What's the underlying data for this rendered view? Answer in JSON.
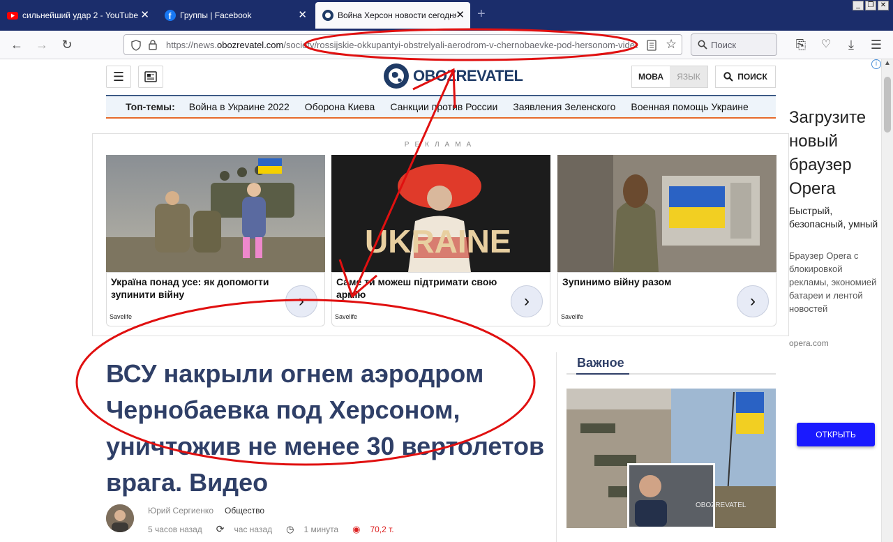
{
  "browser": {
    "tabs": [
      {
        "title": "сильнейший удар 2 - YouTube",
        "icon": "youtube-icon"
      },
      {
        "title": "Группы | Facebook",
        "icon": "facebook-icon"
      },
      {
        "title": "Война Херсон новости сегодня –",
        "icon": "obozrevatel-icon"
      }
    ],
    "url_prefix": "https://news.",
    "url_domain": "obozrevatel.com",
    "url_path": "/society/rossijskie-okkupantyi-obstrelyali-aerodrom-v-chernobaevke-pod-hersonom-video",
    "search_placeholder": "Поиск",
    "colors": {
      "tabbar": "#1b2d6b",
      "annotation": "#e01010"
    }
  },
  "header": {
    "logo_text": "OBOZREVATEL",
    "lang_ua": "МОВА",
    "lang_ru": "ЯЗЫК",
    "search_label": "ПОИСК"
  },
  "topics": {
    "label": "Топ-темы:",
    "items": [
      "Война в Украине 2022",
      "Оборона Киева",
      "Санкции против России",
      "Заявления Зеленского",
      "Военная помощь Украине"
    ]
  },
  "ad": {
    "label": "РЕКЛАМА",
    "cards": [
      {
        "title": "Україна понад усе: як допомогти зупинити війну",
        "source": "Savelife"
      },
      {
        "title": "Саме ти можеш підтримати свою армію",
        "source": "Savelife"
      },
      {
        "title": "Зупинимо війну разом",
        "source": "Savelife"
      }
    ],
    "ukraine_word": "UKRAINE"
  },
  "article": {
    "headline": "ВСУ накрыли огнем аэродром Чернобаевка под Херсоном, уничтожив не менее 30 вертолетов врага. Видео",
    "author": "Юрий Сергиенко",
    "category": "Общество",
    "published": "5 часов назад",
    "updated": "час назад",
    "read_time": "1 минута",
    "views": "70,2 т."
  },
  "sidebar": {
    "title": "Важное",
    "watermark": "OBOZREVATEL"
  },
  "right_ad": {
    "title": "Загрузите новый браузер Opera",
    "subtitle": "Быстрый, безопасный, умный",
    "description": "Браузер Opera с блокировкой рекламы, экономией батареи и лентой новостей",
    "domain": "opera.com",
    "button": "ОТКРЫТЬ",
    "ad_choice": "i"
  }
}
